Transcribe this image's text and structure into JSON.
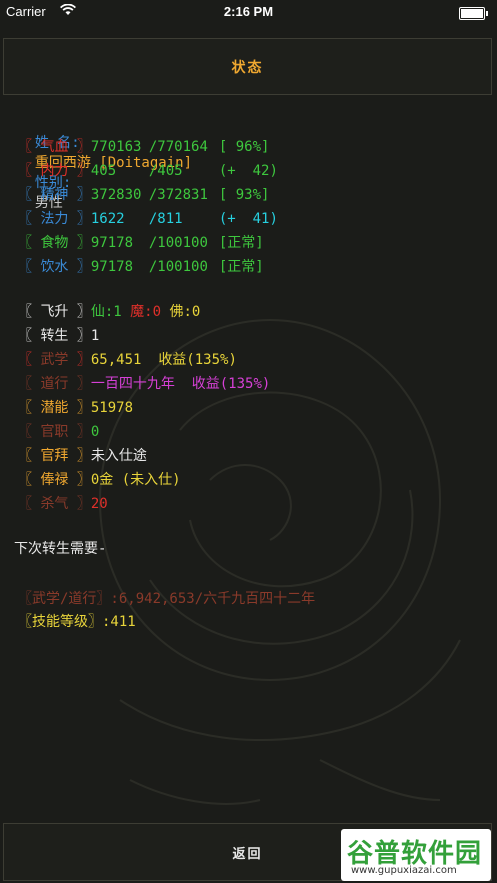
{
  "status_bar": {
    "carrier": "Carrier",
    "time": "2:16 PM"
  },
  "header": {
    "title": "状态"
  },
  "profile": {
    "name_label": "姓 名:",
    "name_value": "重回西游 [Doitagain]",
    "gender_label": "性别:",
    "gender_value": "男性"
  },
  "stats": [
    {
      "label": "气血",
      "current": "770163",
      "max": "/770164",
      "extra": "[ 96%]",
      "label_color": "#e0302a",
      "value_color": "#3ec73e"
    },
    {
      "label": "内力",
      "current": "405",
      "max": "/405",
      "extra": "(+  42)",
      "label_color": "#e0302a",
      "value_color": "#3ec73e"
    },
    {
      "label": "精神",
      "current": "372830",
      "max": "/372831",
      "extra": "[ 93%]",
      "label_color": "#3a8ad6",
      "value_color": "#3ec73e"
    },
    {
      "label": "法力",
      "current": "1622",
      "max": "/811",
      "extra": "(+  41)",
      "label_color": "#3a8ad6",
      "value_color": "#27d0e0"
    },
    {
      "label": "食物",
      "current": "97178",
      "max": "/100100",
      "extra": "[正常]",
      "label_color": "#3ec73e",
      "value_color": "#3ec73e"
    },
    {
      "label": "饮水",
      "current": "97178",
      "max": "/100100",
      "extra": "[正常]",
      "label_color": "#3a8ad6",
      "value_color": "#3ec73e"
    }
  ],
  "attrs": {
    "feisheng": {
      "label": "飞升",
      "xian": "仙:1",
      "mo": "魔:0",
      "fo": "佛:0"
    },
    "zhuansheng": {
      "label": "转生",
      "value": "1"
    },
    "wuxue": {
      "label": "武学",
      "value": "65,451",
      "bonus": "收益(135%)"
    },
    "daoxing": {
      "label": "道行",
      "value": "一百四十九年",
      "bonus": "收益(135%)"
    },
    "qianneng": {
      "label": "潜能",
      "value": "51978"
    },
    "guanzhi": {
      "label": "官职",
      "value": "0"
    },
    "guanbai": {
      "label": "官拜",
      "value": "未入仕途"
    },
    "fenglu": {
      "label": "俸禄",
      "value": "0金 (未入仕)"
    },
    "shaqi": {
      "label": "杀气",
      "value": "20"
    }
  },
  "requirements": {
    "heading": "下次转生需要-",
    "line1": "〖武学/道行〗:6,942,653/六千九百四十二年",
    "line2": "〖技能等级〗:411"
  },
  "footer": {
    "back_label": "返回"
  },
  "watermark": {
    "title": "谷普软件园",
    "url": "www.gupuxiazai.com"
  },
  "colors": {
    "background": "#1b1c19",
    "title": "#f0a830",
    "orange": "#f0a830",
    "yellow": "#e8d43a",
    "green": "#3ec73e",
    "red": "#e0302a",
    "magenta": "#d640d6",
    "dim_red": "#8a3a2a",
    "blue": "#3a8ad6"
  }
}
